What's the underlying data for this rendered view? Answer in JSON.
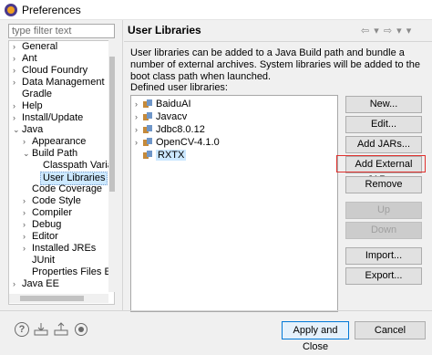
{
  "window": {
    "title": "Preferences"
  },
  "filter": {
    "placeholder": "type filter text"
  },
  "tree": [
    {
      "label": "General",
      "arrow": "›"
    },
    {
      "label": "Ant",
      "arrow": "›"
    },
    {
      "label": "Cloud Foundry",
      "arrow": "›"
    },
    {
      "label": "Data Management",
      "arrow": "›"
    },
    {
      "label": "Gradle",
      "arrow": ""
    },
    {
      "label": "Help",
      "arrow": "›"
    },
    {
      "label": "Install/Update",
      "arrow": "›"
    },
    {
      "label": "Java",
      "arrow": "⌄"
    },
    {
      "label": "Appearance",
      "arrow": "›"
    },
    {
      "label": "Build Path",
      "arrow": "⌄"
    },
    {
      "label": "Classpath Variab",
      "arrow": ""
    },
    {
      "label": "User Libraries",
      "arrow": ""
    },
    {
      "label": "Code Coverage",
      "arrow": ""
    },
    {
      "label": "Code Style",
      "arrow": "›"
    },
    {
      "label": "Compiler",
      "arrow": "›"
    },
    {
      "label": "Debug",
      "arrow": "›"
    },
    {
      "label": "Editor",
      "arrow": "›"
    },
    {
      "label": "Installed JREs",
      "arrow": "›"
    },
    {
      "label": "JUnit",
      "arrow": ""
    },
    {
      "label": "Properties Files Edi",
      "arrow": ""
    },
    {
      "label": "Java EE",
      "arrow": "›"
    }
  ],
  "page": {
    "title": "User Libraries",
    "nav": "⇦ ▾ ⇨ ▾ ▾",
    "description": "User libraries can be added to a Java Build path and bundle a number of external archives. System libraries will be added to the boot class path when launched.",
    "defined_label": "Defined user libraries:"
  },
  "libraries": [
    {
      "label": "BaiduAI",
      "arrow": "›"
    },
    {
      "label": "Javacv",
      "arrow": "›"
    },
    {
      "label": "Jdbc8.0.12",
      "arrow": "›"
    },
    {
      "label": "OpenCV-4.1.0",
      "arrow": "›"
    },
    {
      "label": "RXTX",
      "arrow": ""
    }
  ],
  "buttons": {
    "new": "New...",
    "edit": "Edit...",
    "add_jars": "Add JARs...",
    "add_external_jars": "Add External JARs...",
    "remove": "Remove",
    "up": "Up",
    "down": "Down",
    "import": "Import...",
    "export": "Export..."
  },
  "footer": {
    "help_glyph": "?",
    "apply_close": "Apply and Close",
    "cancel": "Cancel"
  }
}
